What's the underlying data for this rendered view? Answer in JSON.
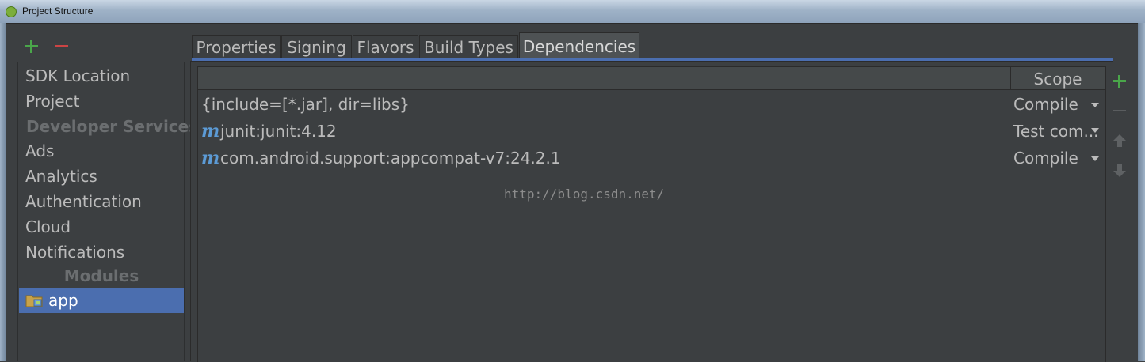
{
  "window": {
    "title": "Project Structure"
  },
  "left_toolbar": {
    "add_icon": "plus-icon",
    "remove_icon": "minus-icon"
  },
  "sidebar": {
    "items": [
      {
        "label": "SDK Location",
        "type": "item"
      },
      {
        "label": "Project",
        "type": "item"
      },
      {
        "label": "Developer Services",
        "type": "header"
      },
      {
        "label": "Ads",
        "type": "item"
      },
      {
        "label": "Analytics",
        "type": "item"
      },
      {
        "label": "Authentication",
        "type": "item"
      },
      {
        "label": "Cloud",
        "type": "item"
      },
      {
        "label": "Notifications",
        "type": "item"
      },
      {
        "label": "Modules",
        "type": "header"
      },
      {
        "label": "app",
        "type": "item",
        "selected": true,
        "icon": "module-folder-icon"
      }
    ]
  },
  "tabs": [
    {
      "label": "Properties"
    },
    {
      "label": "Signing"
    },
    {
      "label": "Flavors"
    },
    {
      "label": "Build Types"
    },
    {
      "label": "Dependencies",
      "active": true
    }
  ],
  "dependencies": {
    "columns": {
      "name": "",
      "scope": "Scope"
    },
    "rows": [
      {
        "name": "{include=[*.jar], dir=libs}",
        "scope": "Compile",
        "icon": ""
      },
      {
        "name": "junit:junit:4.12",
        "scope": "Test com...",
        "icon": "maven-icon"
      },
      {
        "name": "com.android.support:appcompat-v7:24.2.1",
        "scope": "Compile",
        "icon": "maven-icon"
      }
    ],
    "maven_glyph": "m"
  },
  "watermark": "http://blog.csdn.net/",
  "right_toolbar": {
    "buttons": [
      "add-icon",
      "remove-icon",
      "move-up-icon",
      "move-down-icon"
    ]
  },
  "colors": {
    "background": "#3c3f41",
    "selection": "#4b6eaf",
    "add_green": "#4aa64a",
    "remove_red": "#cc4444",
    "maven_blue": "#5c9bd6"
  }
}
